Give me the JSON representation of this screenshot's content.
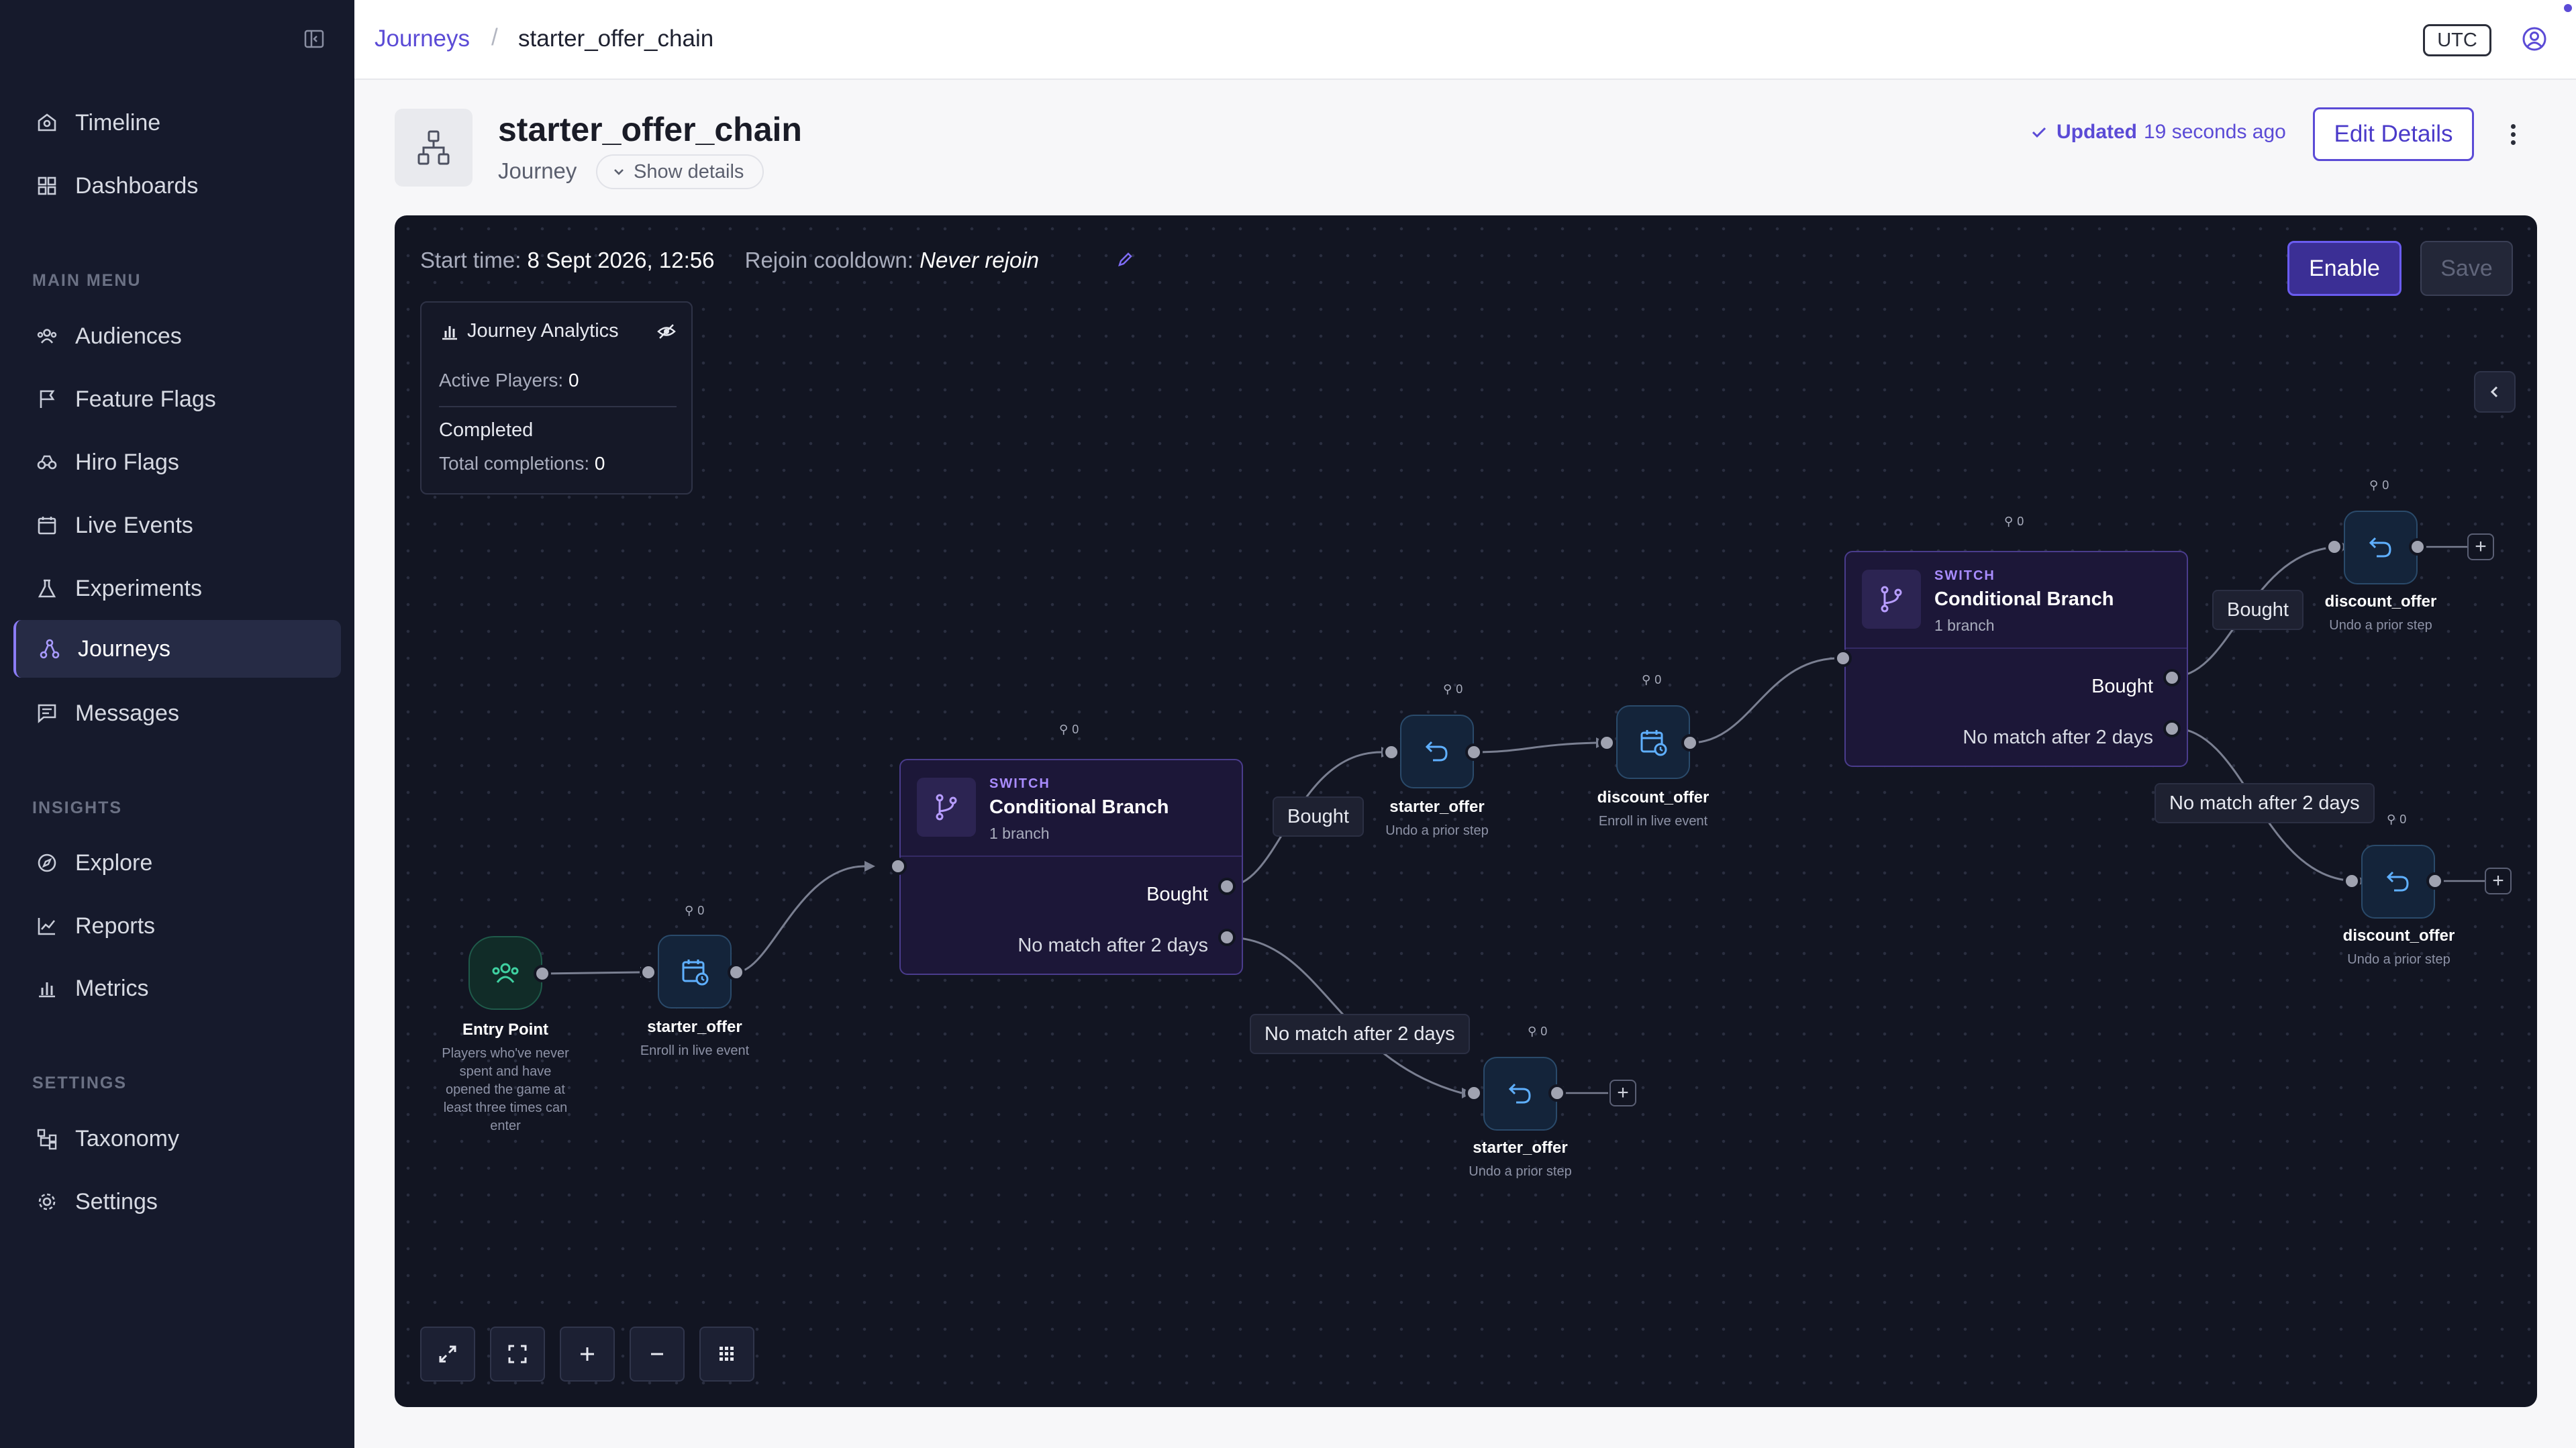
{
  "sidebar": {
    "items_top": [
      {
        "label": "Timeline",
        "icon": "timeline-icon"
      },
      {
        "label": "Dashboards",
        "icon": "dashboard-icon"
      }
    ],
    "sections": {
      "main_menu": "MAIN MENU",
      "insights": "INSIGHTS",
      "settings": "SETTINGS"
    },
    "main_menu": [
      {
        "label": "Audiences",
        "icon": "audiences-icon"
      },
      {
        "label": "Feature Flags",
        "icon": "flag-icon"
      },
      {
        "label": "Hiro Flags",
        "icon": "hiro-flags-icon"
      },
      {
        "label": "Live Events",
        "icon": "calendar-icon"
      },
      {
        "label": "Experiments",
        "icon": "beaker-icon"
      },
      {
        "label": "Journeys",
        "icon": "journeys-icon",
        "active": true
      },
      {
        "label": "Messages",
        "icon": "messages-icon"
      }
    ],
    "insights": [
      {
        "label": "Explore",
        "icon": "compass-icon"
      },
      {
        "label": "Reports",
        "icon": "reports-icon"
      },
      {
        "label": "Metrics",
        "icon": "bar-chart-icon"
      }
    ],
    "settings": [
      {
        "label": "Taxonomy",
        "icon": "taxonomy-icon"
      },
      {
        "label": "Settings",
        "icon": "gear-icon"
      }
    ]
  },
  "topbar": {
    "breadcrumb_root": "Journeys",
    "breadcrumb_sep": "/",
    "breadcrumb_current": "starter_offer_chain",
    "timezone": "UTC"
  },
  "header": {
    "title": "starter_offer_chain",
    "subtitle": "Journey",
    "show_details": "Show details",
    "updated_label": "Updated",
    "updated_time": "19 seconds ago",
    "edit_label": "Edit Details"
  },
  "canvas": {
    "start_label": "Start time:",
    "start_value": "8 Sept 2026, 12:56",
    "cooldown_label": "Rejoin cooldown:",
    "cooldown_value": "Never rejoin",
    "enable_label": "Enable",
    "save_label": "Save",
    "analytics": {
      "title": "Journey Analytics",
      "active_label": "Active Players:",
      "active_value": "0",
      "completed_title": "Completed",
      "completions_label": "Total completions:",
      "completions_value": "0"
    }
  },
  "flow": {
    "entry": {
      "title": "Entry Point",
      "description": "Players who've never spent and have opened the game at least three times can enter"
    },
    "nodes": {
      "n1": {
        "title": "starter_offer",
        "sub": "Enroll in live event",
        "count": "0"
      },
      "n2": {
        "title": "starter_offer",
        "sub": "Undo a prior step",
        "count": "0"
      },
      "n3": {
        "title": "discount_offer",
        "sub": "Enroll in live event",
        "count": "0"
      },
      "n4": {
        "title": "starter_offer",
        "sub": "Undo a prior step",
        "count": "0"
      },
      "n5": {
        "title": "discount_offer",
        "sub": "Undo a prior step",
        "count": "0"
      },
      "n6": {
        "title": "discount_offer",
        "sub": "Undo a prior step",
        "count": "0"
      }
    },
    "branches": {
      "b1": {
        "kind": "SWITCH",
        "title": "Conditional Branch",
        "branches": "1 branch",
        "count": "0",
        "out1": "Bought",
        "out2": "No match after 2 days"
      },
      "b2": {
        "kind": "SWITCH",
        "title": "Conditional Branch",
        "branches": "1 branch",
        "count": "0",
        "out1": "Bought",
        "out2": "No match after 2 days"
      }
    },
    "edge_labels": {
      "bought": "Bought",
      "nomatch": "No match after 2 days"
    },
    "add_symbol": "+"
  },
  "colors": {
    "accent": "#5b4bd6",
    "canvas_bg": "#121522",
    "sidebar_bg": "#161a2c"
  }
}
